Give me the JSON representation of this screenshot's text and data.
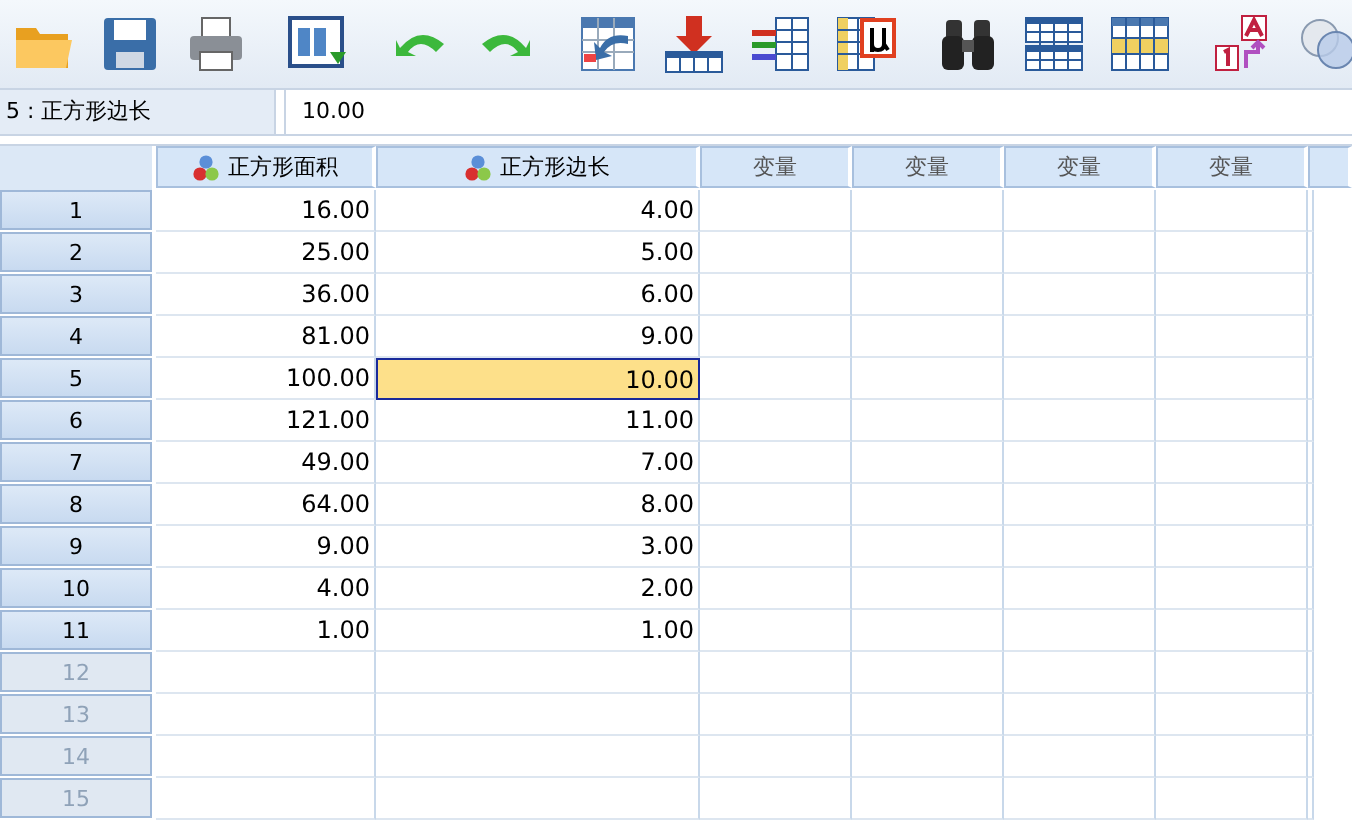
{
  "cell_editor": {
    "cell_ref": "5 : 正方形边长",
    "value": "10.00"
  },
  "columns": [
    {
      "label": "正方形面积",
      "kind": "variable"
    },
    {
      "label": "正方形边长",
      "kind": "variable"
    },
    {
      "label": "变量",
      "kind": "empty"
    },
    {
      "label": "变量",
      "kind": "empty"
    },
    {
      "label": "变量",
      "kind": "empty"
    },
    {
      "label": "变量",
      "kind": "empty"
    }
  ],
  "rows": [
    {
      "number": "1",
      "disabled": false,
      "cells": [
        {
          "text": "16.00",
          "selected": false
        },
        {
          "text": "4.00",
          "selected": false
        }
      ]
    },
    {
      "number": "2",
      "disabled": false,
      "cells": [
        {
          "text": "25.00",
          "selected": false
        },
        {
          "text": "5.00",
          "selected": false
        }
      ]
    },
    {
      "number": "3",
      "disabled": false,
      "cells": [
        {
          "text": "36.00",
          "selected": false
        },
        {
          "text": "6.00",
          "selected": false
        }
      ]
    },
    {
      "number": "4",
      "disabled": false,
      "cells": [
        {
          "text": "81.00",
          "selected": false
        },
        {
          "text": "9.00",
          "selected": false
        }
      ]
    },
    {
      "number": "5",
      "disabled": false,
      "cells": [
        {
          "text": "100.00",
          "selected": false
        },
        {
          "text": "10.00",
          "selected": true
        }
      ]
    },
    {
      "number": "6",
      "disabled": false,
      "cells": [
        {
          "text": "121.00",
          "selected": false
        },
        {
          "text": "11.00",
          "selected": false
        }
      ]
    },
    {
      "number": "7",
      "disabled": false,
      "cells": [
        {
          "text": "49.00",
          "selected": false
        },
        {
          "text": "7.00",
          "selected": false
        }
      ]
    },
    {
      "number": "8",
      "disabled": false,
      "cells": [
        {
          "text": "64.00",
          "selected": false
        },
        {
          "text": "8.00",
          "selected": false
        }
      ]
    },
    {
      "number": "9",
      "disabled": false,
      "cells": [
        {
          "text": "9.00",
          "selected": false
        },
        {
          "text": "3.00",
          "selected": false
        }
      ]
    },
    {
      "number": "10",
      "disabled": false,
      "cells": [
        {
          "text": "4.00",
          "selected": false
        },
        {
          "text": "2.00",
          "selected": false
        }
      ]
    },
    {
      "number": "11",
      "disabled": false,
      "cells": [
        {
          "text": "1.00",
          "selected": false
        },
        {
          "text": "1.00",
          "selected": false
        }
      ]
    },
    {
      "number": "12",
      "disabled": true
    },
    {
      "number": "13",
      "disabled": true
    },
    {
      "number": "14",
      "disabled": true
    },
    {
      "number": "15",
      "disabled": true
    }
  ]
}
